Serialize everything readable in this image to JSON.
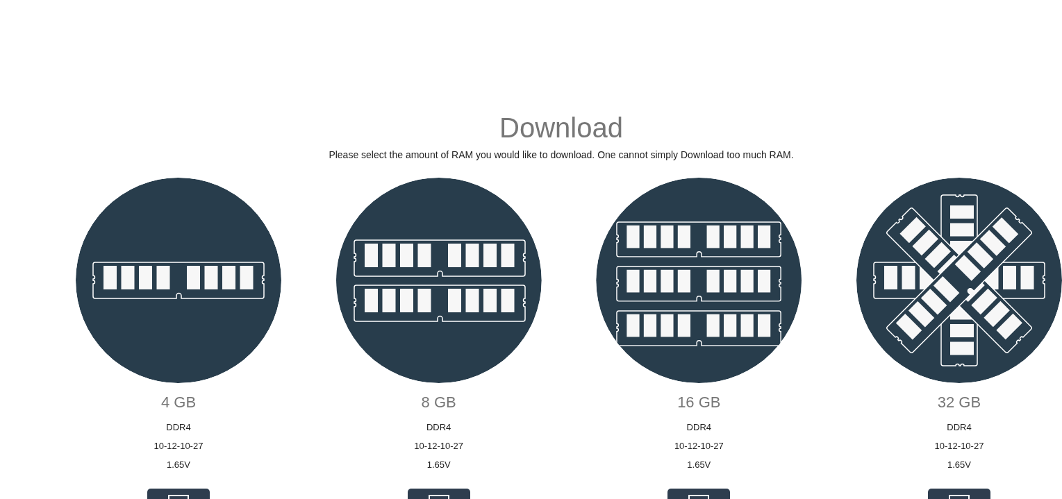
{
  "header": {
    "title": "Download",
    "description": "Please select the amount of RAM you would like to download. One cannot simply Download too much RAM."
  },
  "cards": [
    {
      "kind": "single",
      "capacity": "4 GB",
      "memory_type": "DDR4",
      "timings": "10-12-10-27",
      "voltage": "1.65V"
    },
    {
      "kind": "dual",
      "capacity": "8 GB",
      "memory_type": "DDR4",
      "timings": "10-12-10-27",
      "voltage": "1.65V"
    },
    {
      "kind": "triple",
      "capacity": "16 GB",
      "memory_type": "DDR4",
      "timings": "10-12-10-27",
      "voltage": "1.65V"
    },
    {
      "kind": "radial",
      "capacity": "32 GB",
      "memory_type": "DDR4",
      "timings": "10-12-10-27",
      "voltage": "1.65V"
    }
  ]
}
